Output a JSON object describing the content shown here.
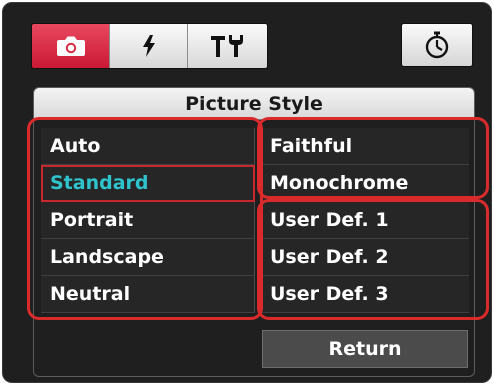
{
  "tabs": [
    {
      "icon": "camera-icon",
      "active": true
    },
    {
      "icon": "flash-icon",
      "active": false
    },
    {
      "icon": "tools-icon",
      "active": false
    }
  ],
  "timer_button": {
    "icon": "timer-icon"
  },
  "panel": {
    "title": "Picture Style",
    "left_column": [
      {
        "label": "Auto",
        "selected": false
      },
      {
        "label": "Standard",
        "selected": true
      },
      {
        "label": "Portrait",
        "selected": false
      },
      {
        "label": "Landscape",
        "selected": false
      },
      {
        "label": "Neutral",
        "selected": false
      }
    ],
    "right_column": [
      {
        "label": "Faithful"
      },
      {
        "label": "Monochrome"
      },
      {
        "label": "User Def. 1"
      },
      {
        "label": "User Def. 2"
      },
      {
        "label": "User Def. 3"
      }
    ],
    "return_label": "Return"
  },
  "colors": {
    "active_tab": "#d72a45",
    "selected_text": "#2fc3cc",
    "highlight": "#d92b2b",
    "background": "#1f1f1f"
  }
}
